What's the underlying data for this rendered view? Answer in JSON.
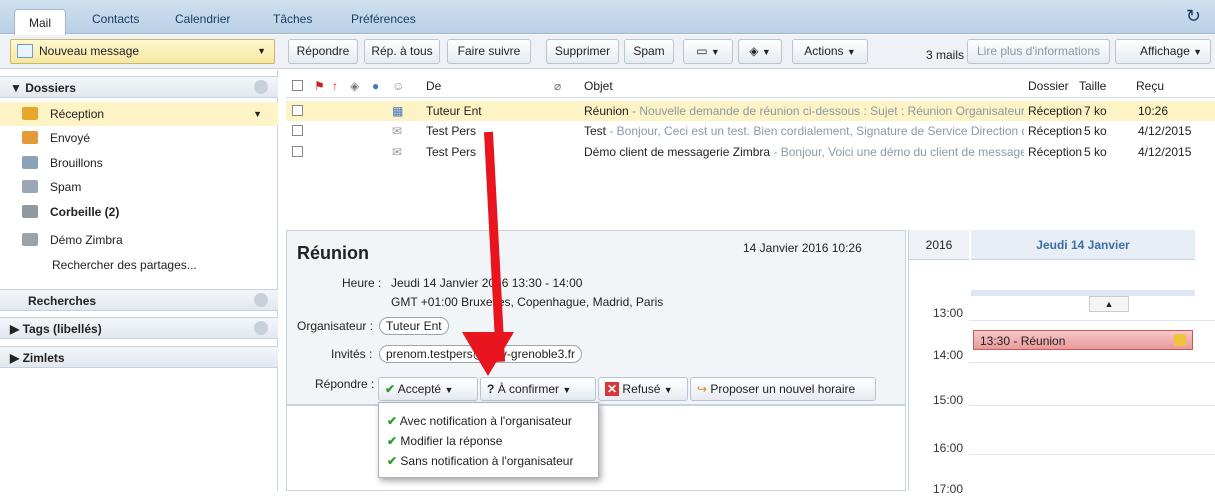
{
  "tabs": [
    "Mail",
    "Contacts",
    "Calendrier",
    "Tâches",
    "Préférences"
  ],
  "toolbar": {
    "new_message": "Nouveau message",
    "reply": "Répondre",
    "reply_all": "Rép. à tous",
    "forward": "Faire suivre",
    "delete": "Supprimer",
    "spam": "Spam",
    "actions": "Actions",
    "mail_count": "3 mails",
    "read_more": "Lire plus d'informations",
    "view": "Affichage"
  },
  "sidebar": {
    "folders_header": "Dossiers",
    "folders": [
      {
        "label": "Réception",
        "icon": "inbox-icon",
        "color": "#e6a72c"
      },
      {
        "label": "Envoyé",
        "icon": "sent-icon",
        "color": "#e39b3a"
      },
      {
        "label": "Brouillons",
        "icon": "drafts-icon",
        "color": "#8aa3b8"
      },
      {
        "label": "Spam",
        "icon": "spam-icon",
        "color": "#9aa8b6"
      },
      {
        "label": "Corbeille (2)",
        "icon": "trash-icon",
        "color": "#9098a0"
      },
      {
        "label": "Démo Zimbra",
        "icon": "folder-icon",
        "color": "#9aa3ac"
      }
    ],
    "search_shares": "Rechercher des partages...",
    "searches": "Recherches",
    "tags": "Tags (libellés)",
    "zimlets": "Zimlets"
  },
  "list": {
    "headers": {
      "from": "De",
      "subject": "Objet",
      "folder": "Dossier",
      "size": "Taille",
      "received": "Reçu"
    },
    "rows": [
      {
        "from": "Tuteur Ent",
        "subject": "Réunion",
        "fragment": " - Nouvelle demande de réunion ci-dessous : Sujet : Réunion Organisateur:",
        "folder": "Réception",
        "size": "7 ko",
        "date": "10:26"
      },
      {
        "from": "Test Pers",
        "subject": "Test",
        "fragment": " - Bonjour, Ceci est un test. Bien cordialement, Signature de Service Direction d",
        "folder": "Réception",
        "size": "5 ko",
        "date": "4/12/2015"
      },
      {
        "from": "Test Pers",
        "subject": "Démo client de messagerie Zimbra",
        "fragment": " - Bonjour, Voici une démo du client de messagerie",
        "folder": "Réception",
        "size": "5 ko",
        "date": "4/12/2015"
      }
    ]
  },
  "reading": {
    "title": "Réunion",
    "date": "14 Janvier 2016 10:26",
    "time_label": "Heure :",
    "time_value": "Jeudi 14 Janvier 2016 13:30 - 14:00",
    "tz": "GMT +01:00 Bruxelles, Copenhague, Madrid, Paris",
    "organizer_label": "Organisateur :",
    "organizer": "Tuteur Ent",
    "invitees_label": "Invités :",
    "invitee": "prenom.testpers@univ-grenoble3.fr",
    "reply_label": "Répondre :",
    "accept": "Accepté",
    "tentative": "À confirmer",
    "decline": "Refusé",
    "propose": "Proposer un nouvel horaire"
  },
  "menu": [
    "Avec notification à l'organisateur",
    "Modifier la réponse",
    "Sans notification à l'organisateur"
  ],
  "calendar": {
    "year": "2016",
    "day": "Jeudi 14 Janvier",
    "hours": [
      "13:00",
      "14:00",
      "15:00",
      "16:00",
      "17:00"
    ],
    "event": "13:30 - Réunion"
  }
}
